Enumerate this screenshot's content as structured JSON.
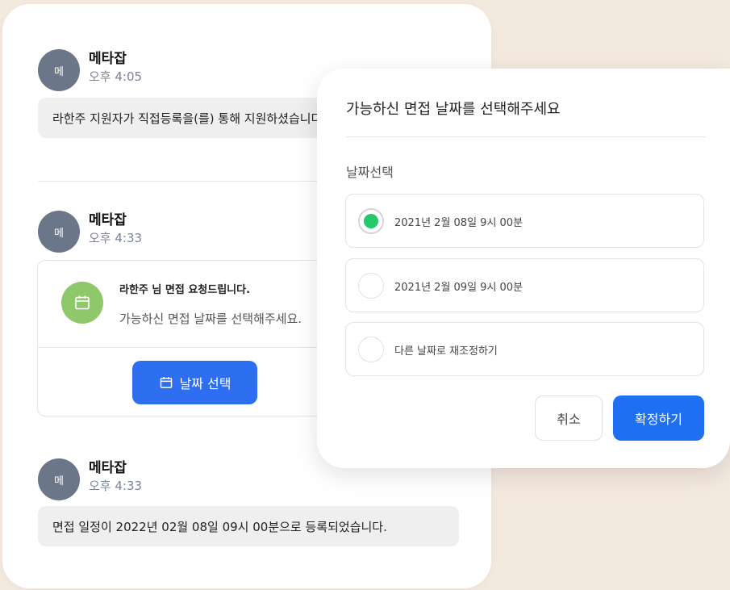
{
  "chat": {
    "messages": [
      {
        "avatar": "메",
        "sender": "메타잡",
        "time": "오후 4:05",
        "text": "라한주 지원자가 직접등록을(를) 통해 지원하셨습니다."
      },
      {
        "avatar": "메",
        "sender": "메타잡",
        "time": "오후 4:33"
      },
      {
        "avatar": "메",
        "sender": "메타잡",
        "time": "오후 4:33",
        "text": "면접 일정이 2022년 02월 08일 09시 00분으로 등록되었습니다."
      }
    ],
    "interview_card": {
      "icon": "calendar-icon",
      "title": "라한주 님 면접 요청드립니다.",
      "subtitle": "가능하신 면접 날짜를 선택해주세요.",
      "button_label": "날짜 선택"
    }
  },
  "modal": {
    "title": "가능하신 면접 날짜를 선택해주세요",
    "section_label": "날짜선택",
    "options": [
      {
        "label": "2021년 2월 08일 9시 00분",
        "selected": true
      },
      {
        "label": "2021년 2월 09일 9시 00분",
        "selected": false
      },
      {
        "label": "다른 날짜로 재조정하기",
        "selected": false
      }
    ],
    "cancel_label": "취소",
    "confirm_label": "확정하기"
  },
  "colors": {
    "background": "#f4e9df",
    "accent_blue": "#2e6ff2",
    "radio_green": "#27c86c",
    "calendar_green": "#8ec86a",
    "avatar_gray": "#6c7689"
  }
}
